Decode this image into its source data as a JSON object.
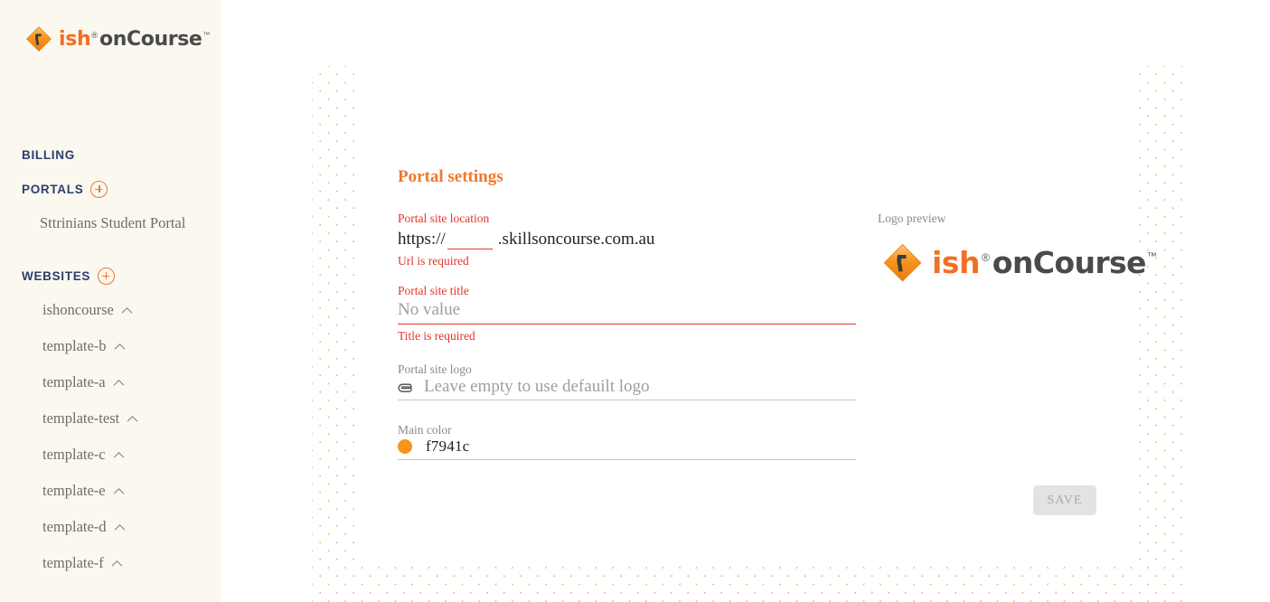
{
  "brand": {
    "logo_ish": "ish",
    "logo_registered": "®",
    "logo_oncourse": "onCourse",
    "logo_tm": "™",
    "accent_color": "#f0772c",
    "brand_orange": "#f26f21",
    "nav_heading_color": "#2d3e6b",
    "error_color": "#e4352b"
  },
  "sidebar": {
    "sections": [
      {
        "label": "BILLING",
        "has_add": false
      },
      {
        "label": "PORTALS",
        "has_add": true
      },
      {
        "label": "WEBSITES",
        "has_add": true
      }
    ],
    "portals": [
      {
        "label": "Sttrinians Student Portal"
      }
    ],
    "websites": [
      {
        "label": "ishoncourse"
      },
      {
        "label": "template-b"
      },
      {
        "label": "template-a"
      },
      {
        "label": "template-test"
      },
      {
        "label": "template-c"
      },
      {
        "label": "template-e"
      },
      {
        "label": "template-d"
      },
      {
        "label": "template-f"
      }
    ]
  },
  "form": {
    "title": "Portal settings",
    "site_location": {
      "label": "Portal site location",
      "prefix": "https://",
      "value": "",
      "suffix": ".skillsoncourse.com.au",
      "error": "Url is required"
    },
    "site_title": {
      "label": "Portal site title",
      "value": "",
      "placeholder": "No value",
      "error": "Title is required"
    },
    "site_logo": {
      "label": "Portal site logo",
      "value": "",
      "placeholder": "Leave empty to use defauilt logo"
    },
    "main_color": {
      "label": "Main color",
      "value": "f7941c",
      "swatch": "#f7941c"
    },
    "save_label": "SAVE"
  },
  "preview": {
    "label": "Logo preview"
  }
}
